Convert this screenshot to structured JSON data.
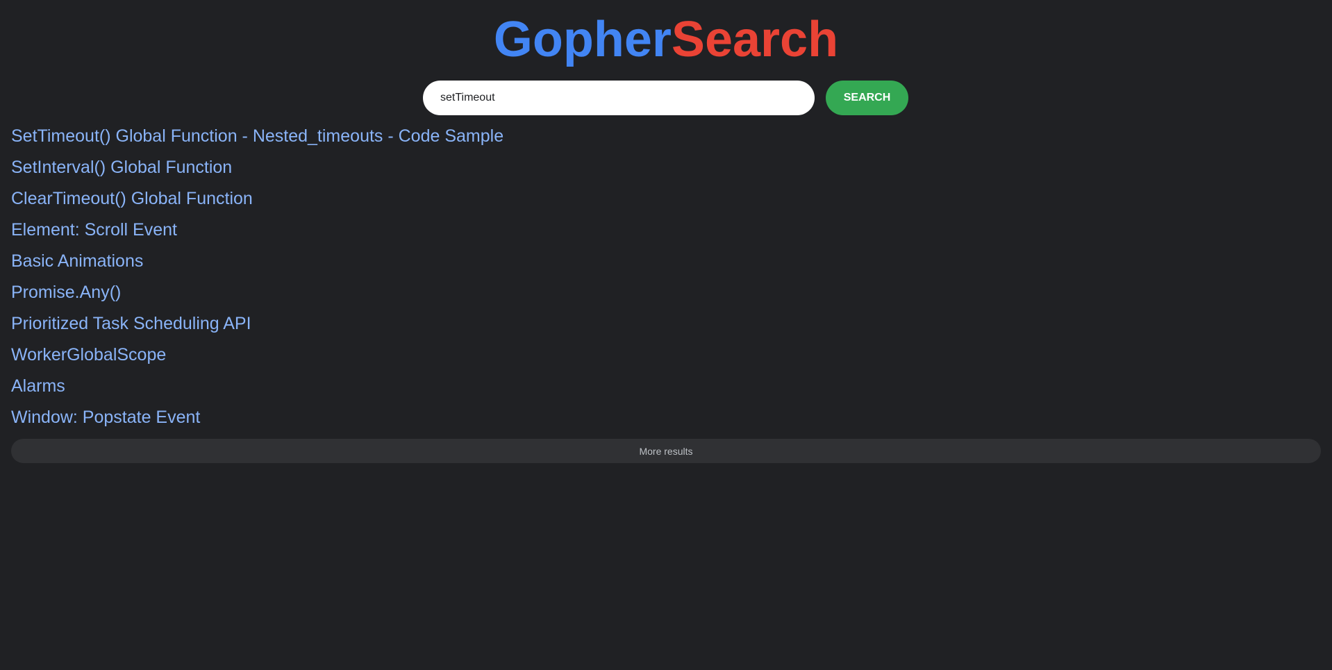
{
  "logo": {
    "part1": "Gopher",
    "part2": "Search",
    "part1_color": "#4285f4",
    "part2_color": "#ea4335"
  },
  "search": {
    "value": "setTimeout",
    "button_label": "SEARCH",
    "button_color": "#34a853"
  },
  "results": [
    {
      "title": "SetTimeout() Global Function - Nested_timeouts - Code Sample"
    },
    {
      "title": "SetInterval() Global Function"
    },
    {
      "title": "ClearTimeout() Global Function"
    },
    {
      "title": "Element: Scroll Event"
    },
    {
      "title": "Basic Animations"
    },
    {
      "title": "Promise.Any()"
    },
    {
      "title": "Prioritized Task Scheduling API"
    },
    {
      "title": "WorkerGlobalScope"
    },
    {
      "title": "Alarms"
    },
    {
      "title": "Window: Popstate Event"
    }
  ],
  "more_results_label": "More results",
  "colors": {
    "background": "#202124",
    "link": "#8ab4f8"
  }
}
